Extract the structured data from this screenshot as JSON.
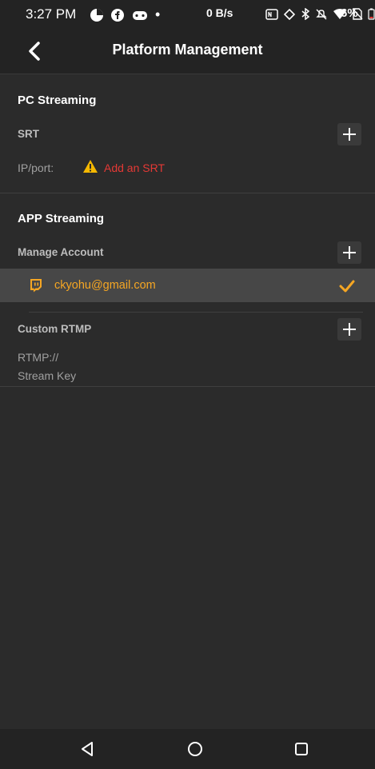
{
  "status_bar": {
    "time": "3:27 PM",
    "network_speed": "0 B/s",
    "battery": "6%",
    "dot": "•"
  },
  "header": {
    "title": "Platform Management",
    "back_icon": "chevron-left-icon"
  },
  "pc_streaming": {
    "title": "PC Streaming",
    "srt_label": "SRT",
    "ip_port_label": "IP/port:",
    "add_srt_link": "Add an SRT"
  },
  "app_streaming": {
    "title": "APP Streaming",
    "manage_account_label": "Manage Account",
    "accounts": [
      {
        "email": "ckyohu@gmail.com",
        "platform_icon": "twitch-icon",
        "selected": true
      }
    ],
    "custom_rtmp_label": "Custom RTMP",
    "rtmp_label": "RTMP://",
    "stream_key_label": "Stream Key"
  },
  "colors": {
    "background": "#2b2b2b",
    "accent_orange": "#f5a623",
    "warning_red": "#e53935",
    "warning_yellow": "#f5b800"
  }
}
